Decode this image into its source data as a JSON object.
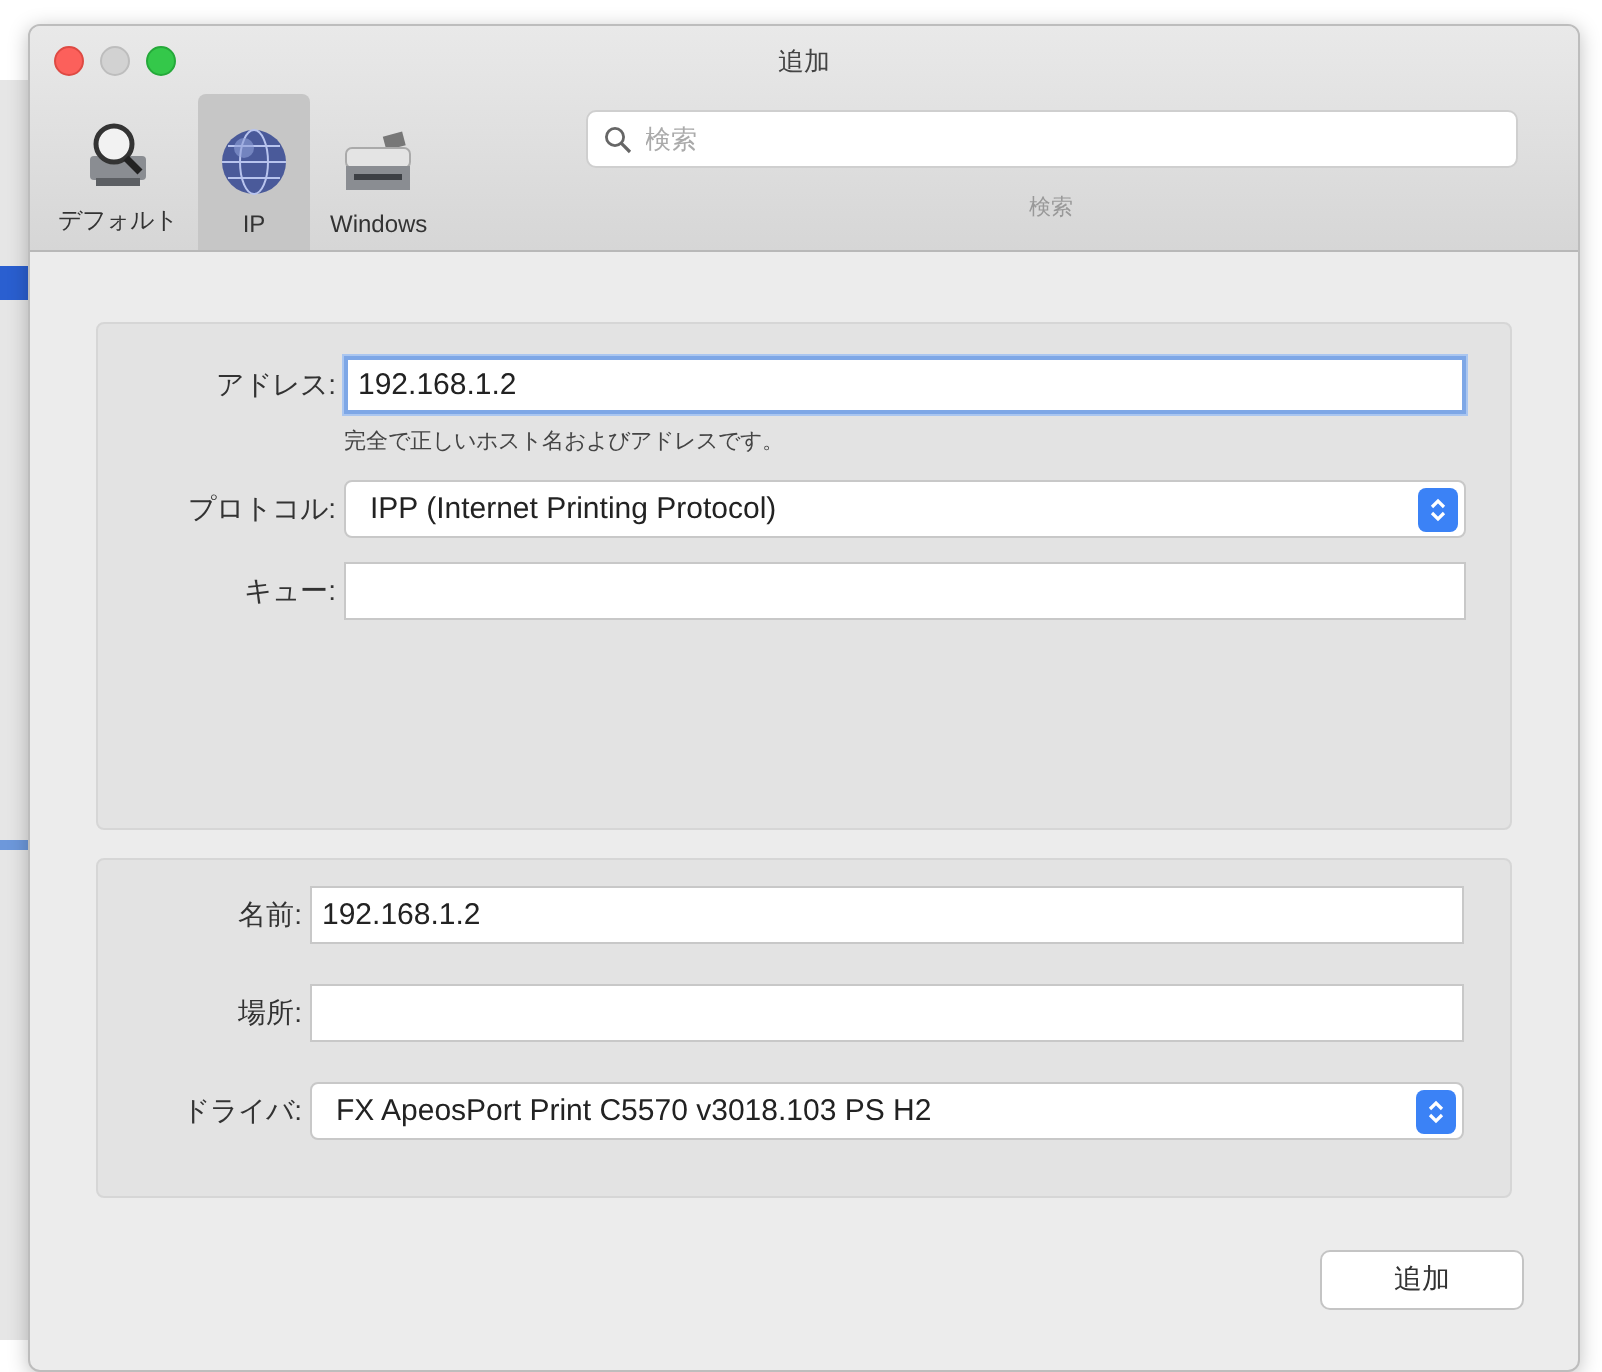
{
  "window": {
    "title": "追加"
  },
  "toolbar": {
    "tabs": [
      {
        "label": "デフォルト",
        "kind": "default",
        "selected": false
      },
      {
        "label": "IP",
        "kind": "ip",
        "selected": true
      },
      {
        "label": "Windows",
        "kind": "windows",
        "selected": false
      }
    ],
    "search": {
      "placeholder": "検索",
      "label": "検索"
    }
  },
  "connection_panel": {
    "fields": [
      {
        "kind": "text",
        "label": "アドレス:",
        "value": "192.168.1.2",
        "focused": true
      },
      {
        "kind": "hint",
        "text": "完全で正しいホスト名およびアドレスです。"
      },
      {
        "kind": "popup",
        "label": "プロトコル:",
        "value": "IPP (Internet Printing Protocol)"
      },
      {
        "kind": "text",
        "label": "キュー:",
        "focused": false
      }
    ]
  },
  "printer_panel": {
    "fields": [
      {
        "kind": "text",
        "label": "名前:",
        "value": "192.168.1.2",
        "focused": false
      },
      {
        "kind": "text",
        "label": "場所:",
        "focused": false
      },
      {
        "kind": "popup",
        "label": "ドライバ:",
        "value": "FX ApeosPort Print C5570 v3018.103 PS H2"
      }
    ]
  },
  "buttons": [
    {
      "label": "追加"
    }
  ]
}
